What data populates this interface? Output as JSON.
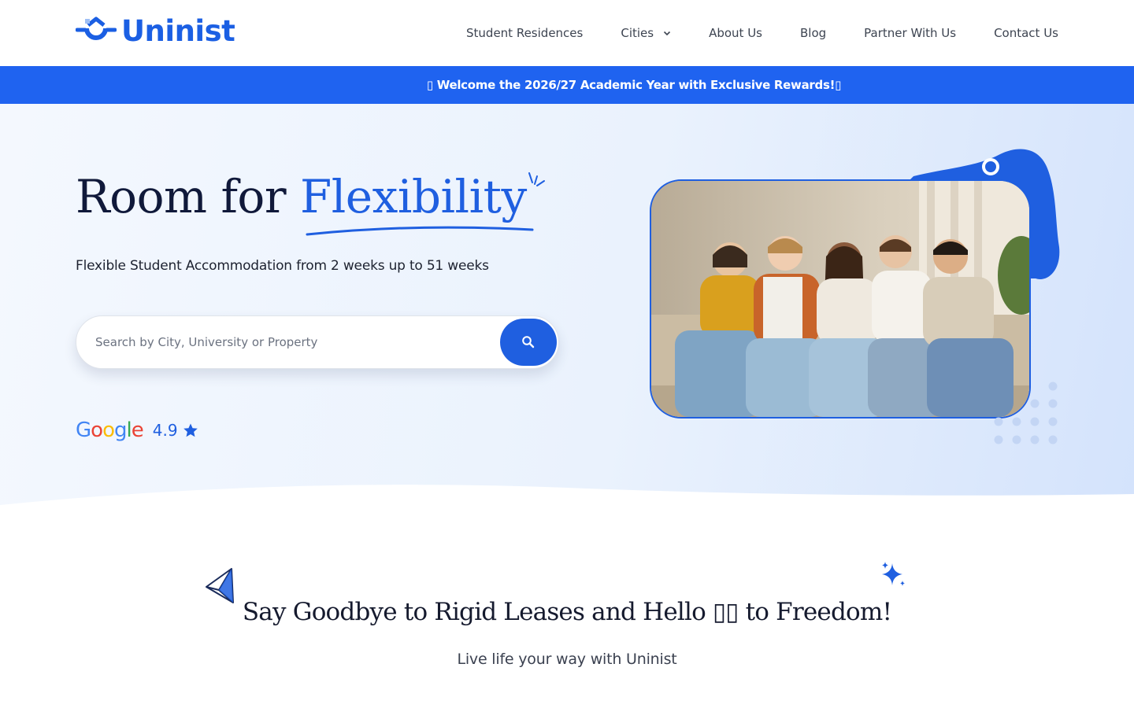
{
  "brand": {
    "name": "Uninist",
    "accent": "#1f5fe0"
  },
  "nav": {
    "items": [
      {
        "label": "Student Residences"
      },
      {
        "label": "Cities"
      },
      {
        "label": "About Us"
      },
      {
        "label": "Blog"
      },
      {
        "label": "Partner With Us"
      },
      {
        "label": "Contact Us"
      }
    ]
  },
  "banner": {
    "text": "▯ Welcome the 2026/27 Academic Year with Exclusive Rewards!▯"
  },
  "hero": {
    "title_plain": "Room for ",
    "title_accent": "Flexibility",
    "subtitle": "Flexible Student Accommodation from 2 weeks up to 51 weeks",
    "search": {
      "placeholder": "Search by City, University or Property"
    },
    "rating": {
      "brand": "Google",
      "value": "4.9",
      "icon": "star-icon"
    },
    "photo": {
      "icon": "students-on-sofa-photo"
    }
  },
  "section": {
    "title": "Say Goodbye to Rigid Leases and Hello ▯▯ to Freedom!",
    "subtitle": "Live life your way with Uninist"
  }
}
